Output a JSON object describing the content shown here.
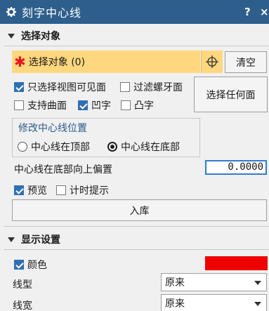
{
  "window": {
    "title": "刻字中心线",
    "help": "?",
    "close": "×"
  },
  "select_section": {
    "heading": "选择对象",
    "select_label": "选择对象 (0)",
    "clear_button": "清空",
    "only_visible": {
      "label": "只选择视图可见面",
      "checked": true
    },
    "filter_thread": {
      "label": "过滤螺牙面",
      "checked": false
    },
    "any_face_button": "选择任何面",
    "support_surface": {
      "label": "支持曲面",
      "checked": false
    },
    "concave": {
      "label": "凹字",
      "checked": true
    },
    "convex": {
      "label": "凸字",
      "checked": false
    }
  },
  "position_group": {
    "title": "修改中心线位置",
    "top": {
      "label": "中心线在顶部",
      "selected": false
    },
    "bottom": {
      "label": "中心线在底部",
      "selected": true
    }
  },
  "offset": {
    "label": "中心线在底部向上偏置",
    "value": "0.0000"
  },
  "preview": {
    "label": "预览",
    "checked": true
  },
  "timer": {
    "label": "计时提示",
    "checked": false
  },
  "store_button": "入库",
  "display_section": {
    "heading": "显示设置",
    "color": {
      "label": "颜色",
      "checked": true,
      "value": "#ee0000"
    },
    "linetype": {
      "label": "线型",
      "value": "原来"
    },
    "linewidth": {
      "label": "线宽",
      "value": "原来"
    }
  },
  "colors": {
    "titlebar": "#2d5e8c",
    "selection_highlight": "#fed77e",
    "accent": "#2f6fb3"
  }
}
